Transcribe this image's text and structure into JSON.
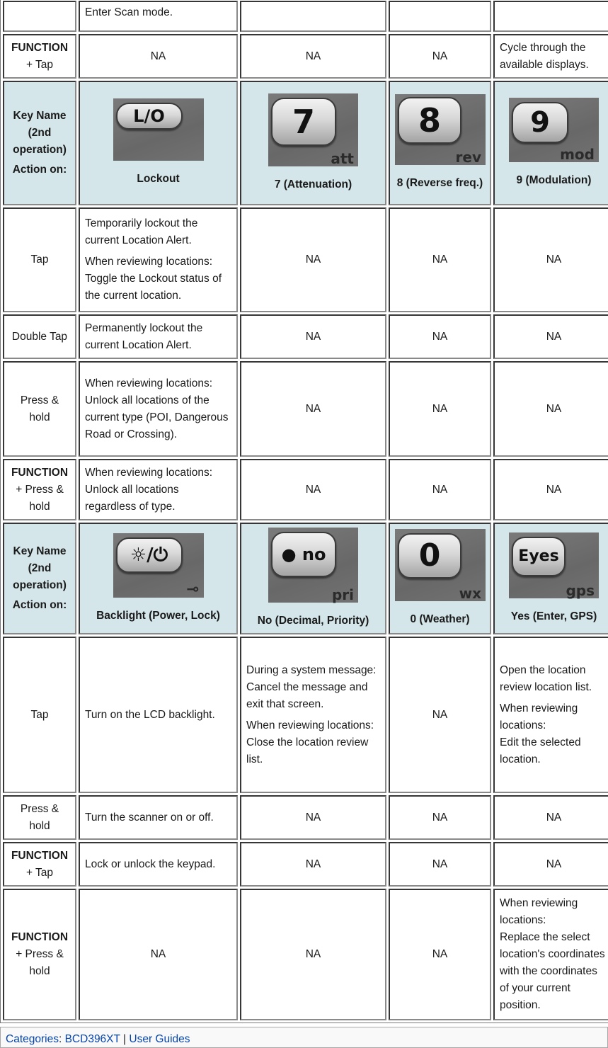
{
  "header_labels": {
    "key_name": "Key Name",
    "second_op": "(2nd operation)",
    "action_on": "Action on:"
  },
  "rows_top": [
    {
      "action": "",
      "cells": [
        "Enter Scan mode.",
        "",
        "",
        ""
      ]
    },
    {
      "action_bold": "FUNCTION",
      "action_rest": "+ Tap",
      "cells": [
        "NA",
        "NA",
        "NA",
        "Cycle through the available displays."
      ]
    }
  ],
  "keys_group1": [
    {
      "icon": "lockout-key-icon",
      "face": "L/O",
      "sub": "",
      "name": "Lockout"
    },
    {
      "icon": "seven-key-icon",
      "face": "7",
      "sub": "att",
      "name": "7 (Attenuation)"
    },
    {
      "icon": "eight-key-icon",
      "face": "8",
      "sub": "rev",
      "name": "8 (Reverse freq.)"
    },
    {
      "icon": "nine-key-icon",
      "face": "9",
      "sub": "mod",
      "name": "9 (Modulation)"
    }
  ],
  "rows_group1": [
    {
      "action_plain": "Tap",
      "cells": [
        [
          "Temporarily lockout the current Location Alert.",
          "When reviewing locations: Toggle the Lockout status of the current location."
        ],
        [
          "NA"
        ],
        [
          "NA"
        ],
        [
          "NA"
        ]
      ]
    },
    {
      "action_plain": "Double Tap",
      "cells": [
        [
          "Permanently lockout the current Location Alert."
        ],
        [
          "NA"
        ],
        [
          "NA"
        ],
        [
          "NA"
        ]
      ]
    },
    {
      "action_plain": "Press & hold",
      "cells": [
        [
          "When reviewing locations: Unlock all locations of the current type (POI, Dangerous Road or Crossing)."
        ],
        [
          "NA"
        ],
        [
          "NA"
        ],
        [
          "NA"
        ]
      ]
    },
    {
      "action_bold": "FUNCTION",
      "action_rest": "+ Press & hold",
      "cells": [
        [
          "When reviewing locations: Unlock all locations regardless of type."
        ],
        [
          "NA"
        ],
        [
          "NA"
        ],
        [
          "NA"
        ]
      ]
    }
  ],
  "keys_group2": [
    {
      "icon": "backlight-power-key-icon",
      "face": "☼/⏻",
      "sub": "⊸",
      "name": "Backlight (Power, Lock)"
    },
    {
      "icon": "no-decimal-key-icon",
      "face": "● no",
      "sub": "pri",
      "name": "No (Decimal, Priority)"
    },
    {
      "icon": "zero-key-icon",
      "face": "0",
      "sub": "wx",
      "name": "0 (Weather)"
    },
    {
      "icon": "yes-enter-key-icon",
      "face": "Eyes",
      "sub": "gps",
      "name": "Yes (Enter, GPS)"
    }
  ],
  "rows_group2": [
    {
      "action_plain": "Tap",
      "cells": [
        [
          "Turn on the LCD backlight."
        ],
        [
          "During a system message: Cancel the message and exit that screen.",
          "When reviewing locations:\nClose the location review list."
        ],
        [
          "NA"
        ],
        [
          "Open the location review location list.",
          "When reviewing locations:\nEdit the selected location."
        ]
      ]
    },
    {
      "action_plain": "Press & hold",
      "cells": [
        [
          "Turn the scanner on or off."
        ],
        [
          "NA"
        ],
        [
          "NA"
        ],
        [
          "NA"
        ]
      ]
    },
    {
      "action_bold": "FUNCTION",
      "action_rest": "+ Tap",
      "cells": [
        [
          "Lock or unlock the keypad."
        ],
        [
          "NA"
        ],
        [
          "NA"
        ],
        [
          "NA"
        ]
      ]
    },
    {
      "action_bold": "FUNCTION",
      "action_rest": "+ Press & hold",
      "cells": [
        [
          "NA"
        ],
        [
          "NA"
        ],
        [
          "NA"
        ],
        [
          "When reviewing locations:\nReplace the select location's coordinates with the coordinates of your current position."
        ]
      ]
    }
  ],
  "footer": {
    "categories_label": "Categories",
    "links": [
      "BCD396XT",
      "User Guides"
    ],
    "separator": "|"
  },
  "colors": {
    "header_bg": "#d4e6ea",
    "link": "#0645ad",
    "key_bg": "#6f6f6f"
  }
}
